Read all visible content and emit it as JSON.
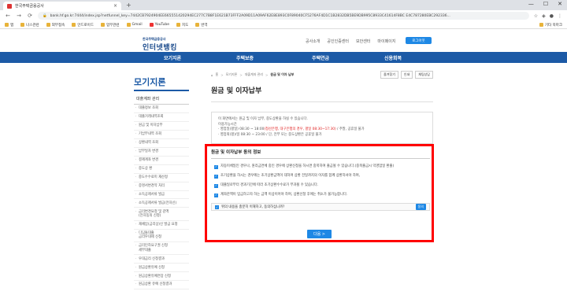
{
  "browser": {
    "tab_title": "한국주택금융공사",
    "tab_close": "×",
    "new_tab": "+",
    "window_controls": [
      "—",
      "☐",
      "✕"
    ],
    "back": "←",
    "forward": "→",
    "reload": "⟳",
    "url": "bank.hf.go.kr:7444/index.jsp?netfunnel_key=7442CB7924904EE665551420294EC277C7B8F1E621B73FFF2A09D11A09AF62E8E893C0F89040CF5276AF4D1C1B2832DB5BE9DB995C8933C41614F8BC E4C787280EBC292336...",
    "bookmarks": [
      "앱",
      "나스관련",
      "외부접속",
      "안드로이드",
      "업무관련",
      "Gmail",
      "YouTube",
      "지도",
      "번역"
    ],
    "bookmarks_other": "기타 북마크"
  },
  "site": {
    "logo_org": "한국주택금융공사",
    "logo_brand": "인터넷뱅킹",
    "top_links": [
      "공사소개",
      "공인인증센터",
      "보안센터",
      "마이페이지"
    ],
    "login_label": "로그아웃",
    "nav": [
      "모기지론",
      "주택보증",
      "주택연금",
      "신용회복"
    ]
  },
  "sidebar": {
    "title": "모기지론",
    "group": "대출계좌 관리",
    "items": [
      "대출정보 조회",
      "대출거래내역조회",
      "원금 및 이자납부",
      "기납부내역 조회",
      "상환내역 조회",
      "납부일자 변경",
      "결제계좌 변경",
      "중도상 환",
      "중도수수료미 재산정",
      "증명서변경약 처리",
      "소득공제서류 발급",
      "소득공제서류 발급(전자신)",
      "금리변경요청 및 감액\n(전자동의 신청)",
      "재채납(금리상)신 발급 요청",
      "디딤돌대출\n금리우대제 신청",
      "금리인하요구권 신청\n세부대출",
      "우대금리 신청결과",
      "원금상환유예 신청",
      "원금상환유예연장 신청",
      "원금상환 유예 신청결과"
    ]
  },
  "content": {
    "breadcrumb": [
      "홈",
      "모기지론",
      "대출계좌 관리",
      "원금 및 이자 납부"
    ],
    "utils": [
      "즐겨찾기",
      "인쇄",
      "채팅상담"
    ],
    "page_title": "원금 및 이자납부",
    "notice": {
      "line1": "이 화면에서는 원금 및 이자 납부, 중도상환을 하실 수 있습니다.",
      "line2": "이용가능시간",
      "line3_pre": "· 영업일(평일) 08:30 ~ 18:00",
      "line3_red": "(청산은행, 대구은행의 경우, 평일 08:30~17:30)",
      "line3_post": " / 주말, 공휴일 불가",
      "line4": "· 영업외(평)/일 08:30 ~ 23:00 / 단, 전부 또는 중도상환은 공휴일 불가"
    },
    "info_title": "원금 및 이자납부 동의 정보",
    "checks": [
      "자동이체일인 경우나, 원리금연체 중인 경우에 상환신청을 하시면 중복하여 출금될 수 있습니다.(중복출금시 익영업일 환출)",
      "조기상환을 하시는 경우에는 조기상환금액이 대하여 상환 전일까지의 이자를 함께 상환하셔야 하며,",
      "대출일로부터 경과기간에 따라 조기상환수수료가 부과될 수 있습니다.",
      "계좌잔액이 입금하고자 하는 금액 이상이어야 하며, 상환신청 후에는 취소가 불가능합니다."
    ],
    "agree_label": "위의 내용을 충분히 이해하고, 동의하십니까?",
    "agree_btn": "동의",
    "next_btn": "다음 >"
  },
  "colors": {
    "nav": "#1c5aa6",
    "accent": "#1e88e5",
    "highlight": "#ff0000"
  }
}
